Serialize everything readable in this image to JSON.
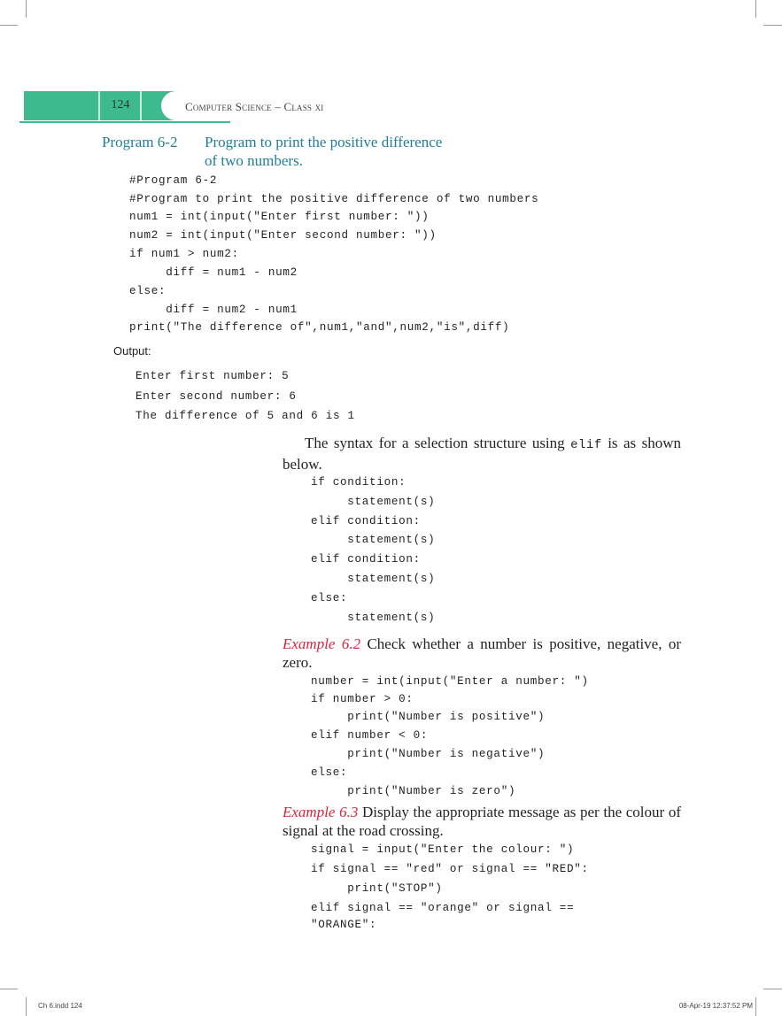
{
  "header": {
    "page_number": "124",
    "running_head": "Computer Science – Class xi",
    "accent_color": "#3dbb8e"
  },
  "program": {
    "number": "Program 6-2",
    "title_line1": "Program to print the positive difference",
    "title_line2": "of two numbers.",
    "caption_color": "#1f7d98",
    "code": [
      "#Program 6-2",
      "#Program to print the positive difference of two numbers",
      "num1 = int(input(\"Enter first number: \"))",
      "num2 = int(input(\"Enter second number: \"))",
      "if num1 > num2:",
      "     diff = num1 - num2",
      "else:",
      "     diff = num2 - num1",
      "print(\"The difference of\",num1,\"and\",num2,\"is\",diff)"
    ]
  },
  "output": {
    "label": "Output:",
    "lines": [
      "Enter first number: 5",
      "Enter second number: 6",
      "The difference of 5 and 6 is 1"
    ]
  },
  "syntax": {
    "text_before": "The syntax for a selection structure using ",
    "keyword": "elif",
    "text_after": " is as shown below.",
    "code": [
      "if condition:",
      "     statement(s)",
      "elif condition:",
      "     statement(s)",
      "elif condition:",
      "     statement(s)",
      "else:",
      "     statement(s)"
    ]
  },
  "example_6_2": {
    "label": "Example 6.2",
    "text": " Check whether a number is positive, negative, or zero.",
    "label_color": "#d7263d",
    "code": [
      "number = int(input(\"Enter a number: \")",
      "if number > 0:",
      "     print(\"Number is positive\")",
      "elif number < 0:",
      "     print(\"Number is negative\")",
      "else:",
      "     print(\"Number is zero\")"
    ]
  },
  "example_6_3": {
    "label": "Example 6.3",
    "text": " Display the appropriate message as per the colour of signal at the road crossing.",
    "code": [
      "signal = input(\"Enter the colour: \")",
      "if signal == \"red\" or signal == \"RED\":",
      "     print(\"STOP\")",
      "elif signal == \"orange\" or signal ==",
      "\"ORANGE\":"
    ]
  },
  "footer": {
    "left": "Ch 6.indd   124",
    "right": "08-Apr-19   12:37:52 PM"
  }
}
